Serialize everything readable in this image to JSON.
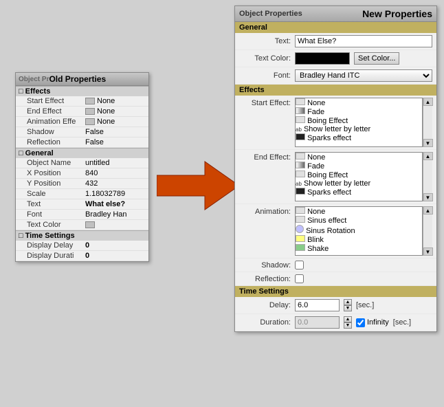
{
  "old_panel": {
    "title": "Object Pr",
    "title_highlight": "Old Properties",
    "sections": {
      "effects": {
        "label": "Effects",
        "rows": [
          {
            "label": "Start Effect",
            "value": "None",
            "has_swatch": true,
            "swatch_color": "#c0c0c0"
          },
          {
            "label": "End Effect",
            "value": "None",
            "has_swatch": true,
            "swatch_color": "#c0c0c0"
          },
          {
            "label": "Animation Effe",
            "value": "None",
            "has_swatch": true,
            "swatch_color": "#c0c0c0"
          },
          {
            "label": "Shadow",
            "value": "False"
          },
          {
            "label": "Reflection",
            "value": "False"
          }
        ]
      },
      "general": {
        "label": "General",
        "rows": [
          {
            "label": "Object Name",
            "value": "untitled"
          },
          {
            "label": "X Position",
            "value": "840"
          },
          {
            "label": "Y Position",
            "value": "432"
          },
          {
            "label": "Scale",
            "value": "1.18032789"
          },
          {
            "label": "Text",
            "value": "What else?",
            "bold": true
          },
          {
            "label": "Font",
            "value": "Bradley Han"
          },
          {
            "label": "Text Color",
            "has_swatch": true,
            "swatch_color": "#c0c0c0"
          }
        ]
      },
      "time_settings": {
        "label": "Time Settings",
        "rows": [
          {
            "label": "Display Delay",
            "value": "0"
          },
          {
            "label": "Display Durati",
            "value": "0"
          }
        ]
      }
    }
  },
  "new_panel": {
    "title": "Object Properties",
    "title_highlight": "New Properties",
    "general": {
      "label": "General",
      "text_label": "Text:",
      "text_value": "What Else?",
      "text_color_label": "Text Color:",
      "set_color_btn": "Set Color...",
      "font_label": "Font:",
      "font_value": "Bradley Hand ITC"
    },
    "effects": {
      "label": "Effects",
      "start_effect": {
        "label": "Start Effect:",
        "items": [
          {
            "name": "None",
            "type": "none",
            "selected": false
          },
          {
            "name": "Fade",
            "type": "fade",
            "selected": false
          },
          {
            "name": "Boing Effect",
            "type": "boing",
            "selected": true
          },
          {
            "name": "Show letter by letter",
            "type": "ab",
            "selected": false
          },
          {
            "name": "Sparks effect",
            "type": "sparks",
            "selected": false
          }
        ]
      },
      "end_effect": {
        "label": "End Effect:",
        "items": [
          {
            "name": "None",
            "type": "none",
            "selected": true
          },
          {
            "name": "Fade",
            "type": "fade",
            "selected": false
          },
          {
            "name": "Boing Effect",
            "type": "boing",
            "selected": false
          },
          {
            "name": "Show letter by letter",
            "type": "ab",
            "selected": false
          },
          {
            "name": "Sparks effect",
            "type": "sparks",
            "selected": false
          }
        ]
      },
      "animation": {
        "label": "Animation:",
        "items": [
          {
            "name": "None",
            "type": "none",
            "selected": true
          },
          {
            "name": "Sinus effect",
            "type": "sinus",
            "selected": false
          },
          {
            "name": "Sinus Rotation",
            "type": "rotation",
            "selected": false
          },
          {
            "name": "Blink",
            "type": "blink",
            "selected": false
          },
          {
            "name": "Shake",
            "type": "shake",
            "selected": false
          }
        ]
      },
      "shadow_label": "Shadow:",
      "reflection_label": "Reflection:"
    },
    "time_settings": {
      "label": "Time Settings",
      "delay_label": "Delay:",
      "delay_value": "6.0",
      "delay_unit": "[sec.]",
      "duration_label": "Duration:",
      "duration_value": "0.0",
      "duration_unit": "[sec.]",
      "infinity_label": "Infinity"
    }
  }
}
